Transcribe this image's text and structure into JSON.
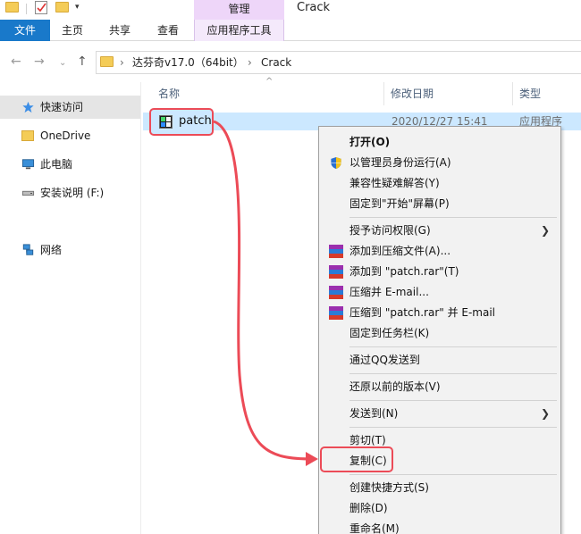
{
  "titlebar": {
    "manage_tab": "管理",
    "window_title": "Crack"
  },
  "ribbon": {
    "tabs": [
      "文件",
      "主页",
      "共享",
      "查看",
      "应用程序工具"
    ]
  },
  "address": {
    "segments": [
      "达芬奇v17.0（64bit）",
      "Crack"
    ]
  },
  "sidebar": {
    "items": [
      {
        "label": "快速访问",
        "icon": "star-icon"
      },
      {
        "label": "OneDrive",
        "icon": "folder-icon"
      },
      {
        "label": "此电脑",
        "icon": "computer-icon"
      },
      {
        "label": "安装说明 (F:)",
        "icon": "drive-icon"
      },
      {
        "label": "网络",
        "icon": "network-icon"
      }
    ]
  },
  "columns": {
    "name": "名称",
    "date": "修改日期",
    "type": "类型"
  },
  "file": {
    "name": "patch",
    "date": "2020/12/27 15:41",
    "type": "应用程序"
  },
  "context_menu": {
    "items": [
      {
        "label": "打开(O)",
        "bold": true
      },
      {
        "label": "以管理员身份运行(A)",
        "icon": "shield-icon"
      },
      {
        "label": "兼容性疑难解答(Y)"
      },
      {
        "label": "固定到\"开始\"屏幕(P)"
      },
      {
        "label": "授予访问权限(G)",
        "submenu": true
      },
      {
        "label": "添加到压缩文件(A)...",
        "icon": "winrar-icon"
      },
      {
        "label": "添加到 \"patch.rar\"(T)",
        "icon": "winrar-icon"
      },
      {
        "label": "压缩并 E-mail...",
        "icon": "winrar-icon"
      },
      {
        "label": "压缩到 \"patch.rar\" 并 E-mail",
        "icon": "winrar-icon"
      },
      {
        "label": "固定到任务栏(K)"
      },
      {
        "label": "通过QQ发送到"
      },
      {
        "label": "还原以前的版本(V)"
      },
      {
        "label": "发送到(N)",
        "submenu": true
      },
      {
        "label": "剪切(T)"
      },
      {
        "label": "复制(C)"
      },
      {
        "label": "创建快捷方式(S)"
      },
      {
        "label": "删除(D)"
      },
      {
        "label": "重命名(M)"
      }
    ]
  },
  "colors": {
    "file_tab": "#1979ca",
    "manage_tab": "#eed6f9",
    "selection": "#cce8ff",
    "highlight": "#ec4b57"
  }
}
